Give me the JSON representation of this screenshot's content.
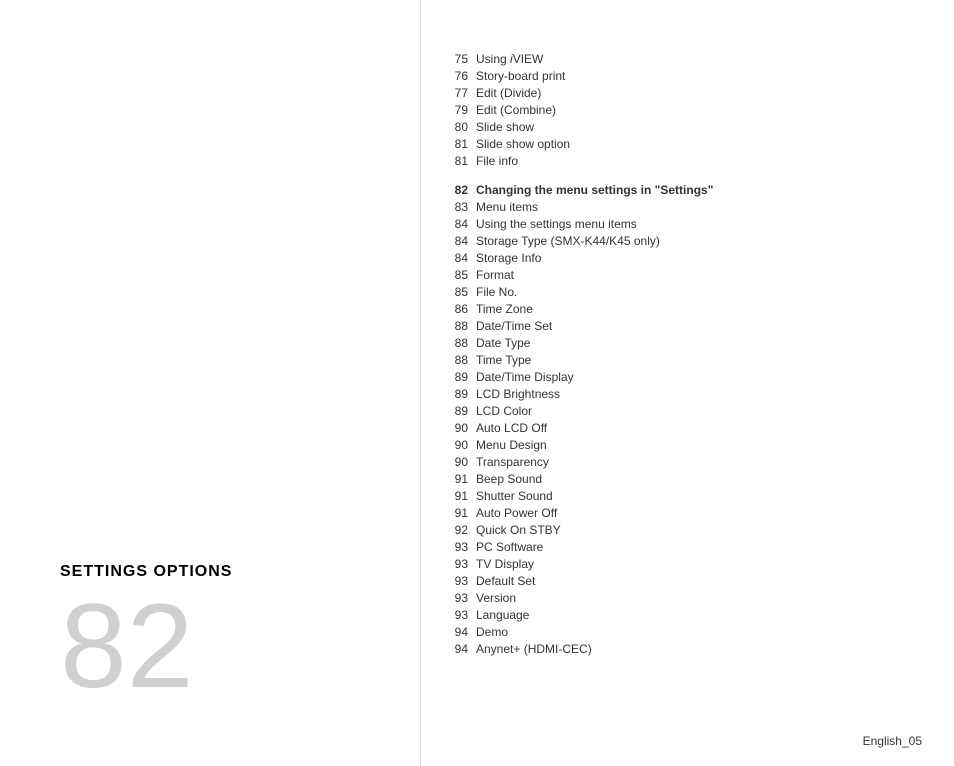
{
  "left": {
    "section_label": "SETTINGS OPTIONS",
    "big_number": "82"
  },
  "toc": {
    "items_top": [
      {
        "num": "75",
        "text": "Using iVIEW",
        "bold": false
      },
      {
        "num": "76",
        "text": "Story-board print",
        "bold": false
      },
      {
        "num": "77",
        "text": "Edit (Divide)",
        "bold": false
      },
      {
        "num": "79",
        "text": "Edit (Combine)",
        "bold": false
      },
      {
        "num": "80",
        "text": "Slide show",
        "bold": false
      },
      {
        "num": "81",
        "text": "Slide show option",
        "bold": false
      },
      {
        "num": "81",
        "text": "File info",
        "bold": false
      }
    ],
    "items_main": [
      {
        "num": "82",
        "text": "Changing the menu settings in \"Settings\"",
        "bold": true
      },
      {
        "num": "83",
        "text": "Menu items",
        "bold": false
      },
      {
        "num": "84",
        "text": "Using the settings menu items",
        "bold": false
      },
      {
        "num": "84",
        "text": "Storage Type (SMX-K44/K45 only)",
        "bold": false
      },
      {
        "num": "84",
        "text": "Storage Info",
        "bold": false
      },
      {
        "num": "85",
        "text": "Format",
        "bold": false
      },
      {
        "num": "85",
        "text": "File No.",
        "bold": false
      },
      {
        "num": "86",
        "text": "Time Zone",
        "bold": false
      },
      {
        "num": "88",
        "text": "Date/Time Set",
        "bold": false
      },
      {
        "num": "88",
        "text": "Date Type",
        "bold": false
      },
      {
        "num": "88",
        "text": "Time Type",
        "bold": false
      },
      {
        "num": "89",
        "text": "Date/Time Display",
        "bold": false
      },
      {
        "num": "89",
        "text": "LCD Brightness",
        "bold": false
      },
      {
        "num": "89",
        "text": "LCD Color",
        "bold": false
      },
      {
        "num": "90",
        "text": "Auto LCD Off",
        "bold": false
      },
      {
        "num": "90",
        "text": "Menu Design",
        "bold": false
      },
      {
        "num": "90",
        "text": "Transparency",
        "bold": false
      },
      {
        "num": "91",
        "text": "Beep Sound",
        "bold": false
      },
      {
        "num": "91",
        "text": "Shutter Sound",
        "bold": false
      },
      {
        "num": "91",
        "text": "Auto Power Off",
        "bold": false
      },
      {
        "num": "92",
        "text": "Quick On STBY",
        "bold": false
      },
      {
        "num": "93",
        "text": "PC Software",
        "bold": false
      },
      {
        "num": "93",
        "text": "TV Display",
        "bold": false
      },
      {
        "num": "93",
        "text": "Default Set",
        "bold": false
      },
      {
        "num": "93",
        "text": "Version",
        "bold": false
      },
      {
        "num": "93",
        "text": "Language",
        "bold": false
      },
      {
        "num": "94",
        "text": "Demo",
        "bold": false
      },
      {
        "num": "94",
        "text": "Anynet+ (HDMI-CEC)",
        "bold": false
      }
    ]
  },
  "footer": {
    "text": "English_05"
  }
}
